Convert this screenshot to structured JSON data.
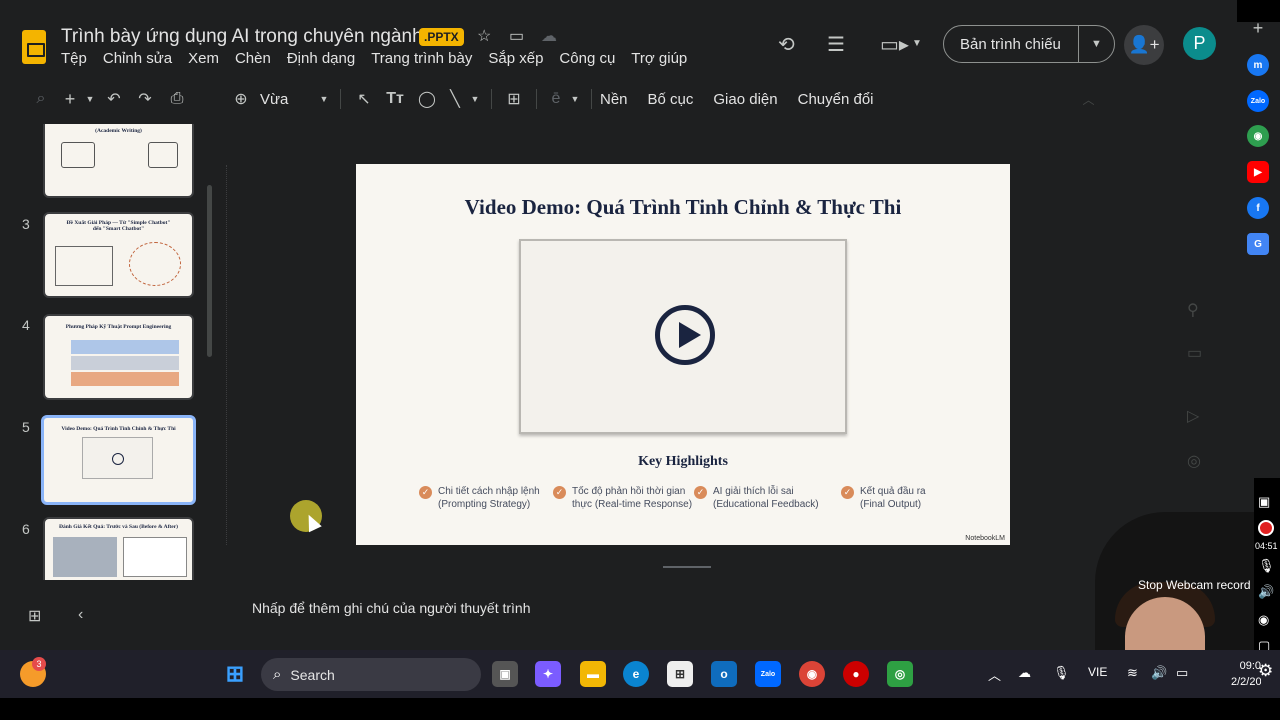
{
  "document": {
    "title": "Trình bày ứng dụng AI trong chuyên ngành",
    "badge": ".PPTX"
  },
  "menu": [
    "Tệp",
    "Chỉnh sửa",
    "Xem",
    "Chèn",
    "Định dạng",
    "Trang trình bày",
    "Sắp xếp",
    "Công cụ",
    "Trợ giúp"
  ],
  "header": {
    "present_label": "Bản trình chiếu",
    "avatar_letter": "P"
  },
  "toolbar": {
    "zoom": "Vừa",
    "background": "Nền",
    "layout": "Bố cục",
    "theme": "Giao diện",
    "transition": "Chuyển đổi"
  },
  "filmstrip": {
    "slides": [
      {
        "num": "",
        "title": "(Academic Writing)"
      },
      {
        "num": "3",
        "title": "Đề Xuất Giải Pháp — Từ \"Simple Chatbot\" đến \"Smart Chatbot\""
      },
      {
        "num": "4",
        "title": "Phương Pháp Kỹ Thuật Prompt Engineering"
      },
      {
        "num": "5",
        "title": "Video Demo: Quá Trình Tinh Chỉnh & Thực Thi"
      },
      {
        "num": "6",
        "title": "Đánh Giá Kết Quả: Trước và Sau (Before & After)"
      }
    ]
  },
  "slide": {
    "title": "Video Demo: Quá Trình Tinh Chỉnh & Thực Thi",
    "highlights_title": "Key Highlights",
    "highlights": [
      {
        "text": "Chi tiết cách nhập lệnh\n(Prompting Strategy)"
      },
      {
        "text": "Tốc độ phản hồi thời gian\nthực (Real-time Response)"
      },
      {
        "text": "AI giải thích lỗi sai\n(Educational Feedback)"
      },
      {
        "text": "Kết quả đầu ra\n(Final Output)"
      }
    ],
    "footer": "NotebookLM"
  },
  "notes": {
    "placeholder": "Nhấp để thêm ghi chú của người thuyết trình"
  },
  "recorder": {
    "time": "04:51",
    "stop_label": "Stop Webcam record"
  },
  "taskbar": {
    "search_label": "Search",
    "notification_count": "3",
    "language": "VIE",
    "time": "09:0",
    "date": "2/2/202"
  },
  "colors": {
    "accent_yellow": "#f4b400",
    "slide_navy": "#1a2440",
    "check_orange": "#d98b5a",
    "selection_blue": "#8ab4f8"
  }
}
